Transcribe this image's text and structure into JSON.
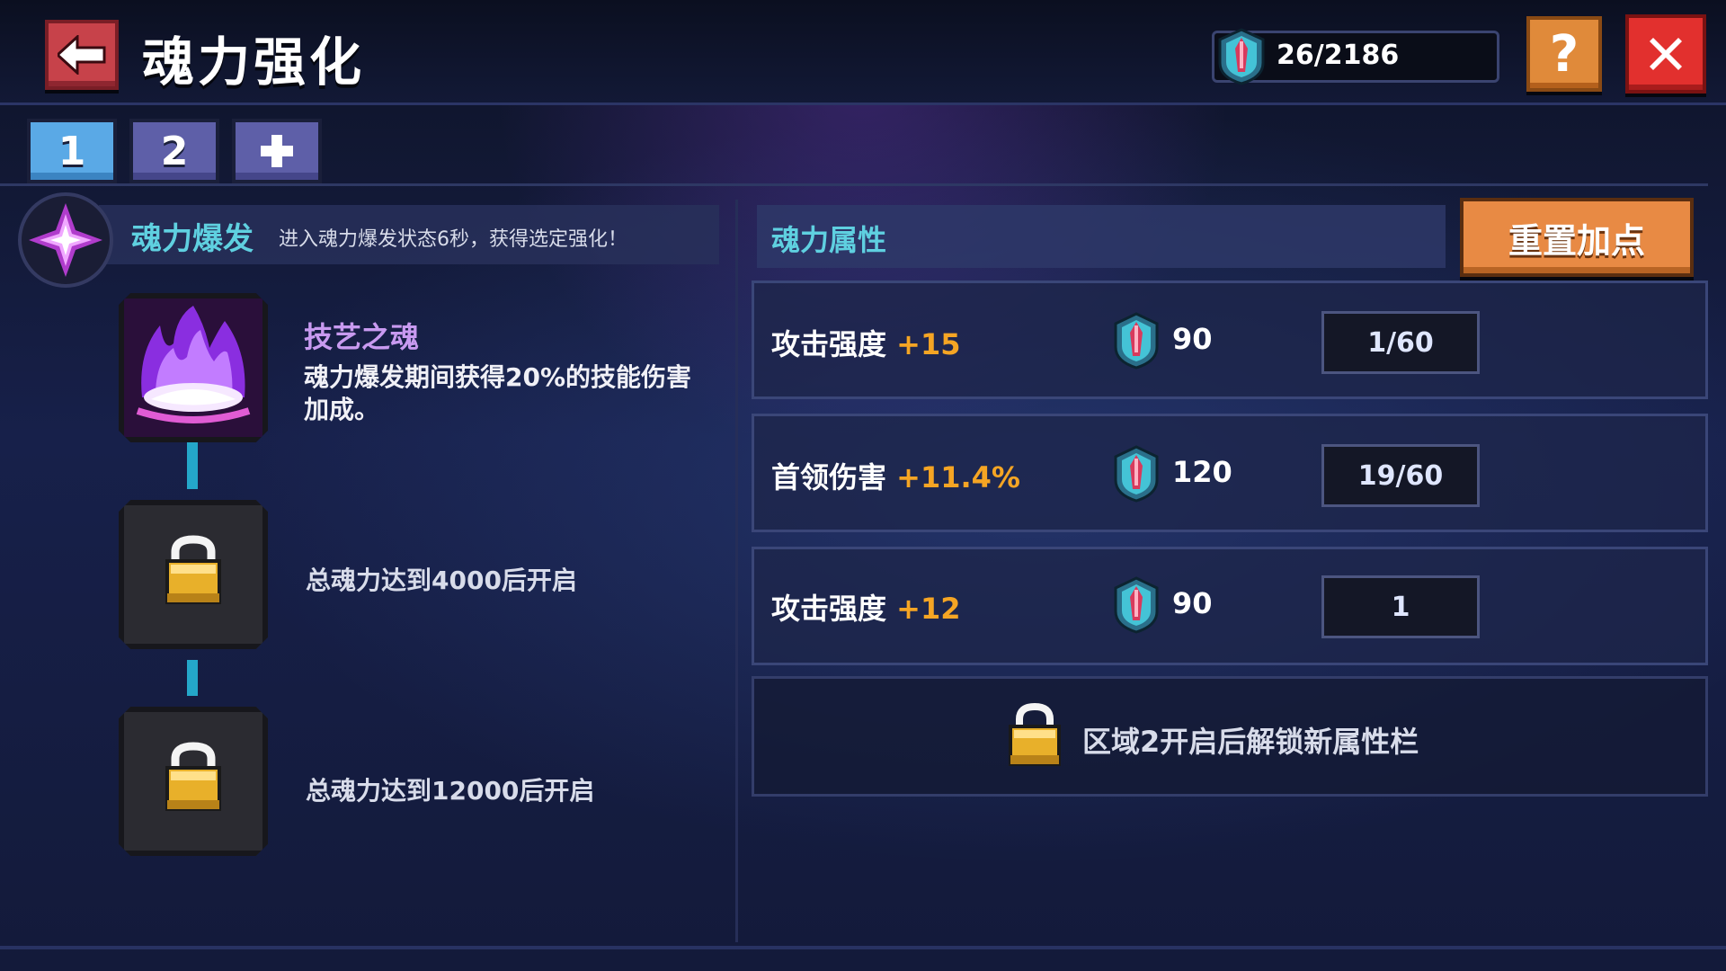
{
  "header": {
    "title": "魂力强化",
    "currency_value": "26/2186",
    "help_label": "?"
  },
  "tabs": [
    {
      "label": "1",
      "active": true
    },
    {
      "label": "2",
      "active": false
    }
  ],
  "soul_burst": {
    "title": "魂力爆发",
    "description": "进入魂力爆发状态6秒，获得选定强化！"
  },
  "skill": {
    "name": "技艺之魂",
    "description": "魂力爆发期间获得20%的技能伤害加成。"
  },
  "locked_nodes": [
    {
      "requirement": "总魂力达到4000后开启"
    },
    {
      "requirement": "总魂力达到12000后开启"
    }
  ],
  "attributes": {
    "title": "魂力属性",
    "reset_label": "重置加点",
    "rows": [
      {
        "name": "攻击强度",
        "bonus": "+15",
        "cost": "90",
        "level": "1/60"
      },
      {
        "name": "首领伤害",
        "bonus": "+11.4%",
        "cost": "120",
        "level": "19/60"
      },
      {
        "name": "攻击强度",
        "bonus": "+12",
        "cost": "90",
        "level": "1"
      }
    ],
    "locked_row_text": "区域2开启后解锁新属性栏"
  },
  "colors": {
    "accent_cyan": "#5fd0e0",
    "bonus_orange": "#f5a524",
    "close_red": "#e2302e",
    "help_orange": "#e08a3a"
  },
  "icons": [
    "back-arrow-icon",
    "soul-crystal-icon",
    "help-icon",
    "close-icon",
    "plus-icon",
    "soul-burst-icon",
    "lock-icon"
  ]
}
